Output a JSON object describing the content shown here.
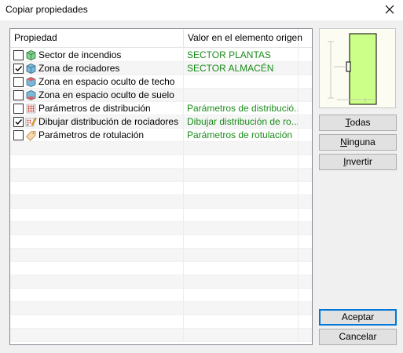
{
  "window": {
    "title": "Copiar propiedades"
  },
  "list": {
    "headers": [
      "Propiedad",
      "Valor en el elemento origen"
    ],
    "rows": [
      {
        "label": "Sector de incendios",
        "value": "SECTOR PLANTAS",
        "checked": false,
        "icon": "fire-sector-icon"
      },
      {
        "label": "Zona de rociadores",
        "value": "SECTOR ALMACÉN",
        "checked": true,
        "icon": "sprinkler-zone-icon"
      },
      {
        "label": "Zona en espacio oculto de techo",
        "value": "",
        "checked": false,
        "icon": "ceiling-space-icon"
      },
      {
        "label": "Zona en espacio oculto de suelo",
        "value": "",
        "checked": false,
        "icon": "floor-space-icon"
      },
      {
        "label": "Parámetros de distribución",
        "value": "Parámetros de distribució...",
        "checked": false,
        "icon": "distribution-grid-icon"
      },
      {
        "label": "Dibujar distribución de rociadores",
        "value": "Dibujar distribución de ro...",
        "checked": true,
        "icon": "draw-distribution-icon"
      },
      {
        "label": "Parámetros de rotulación",
        "value": "Parámetros de rotulación",
        "checked": false,
        "icon": "label-tag-icon"
      }
    ]
  },
  "buttons": {
    "todas": {
      "first": "T",
      "rest": "odas"
    },
    "ninguna": {
      "first": "N",
      "rest": "inguna"
    },
    "invertir": {
      "first": "I",
      "rest": "nvertir"
    },
    "accept": "Aceptar",
    "cancel": "Cancelar"
  },
  "colors": {
    "value_text": "#1a8c1a",
    "preview_fill": "#ccff88",
    "accent_border": "#0078d7"
  }
}
